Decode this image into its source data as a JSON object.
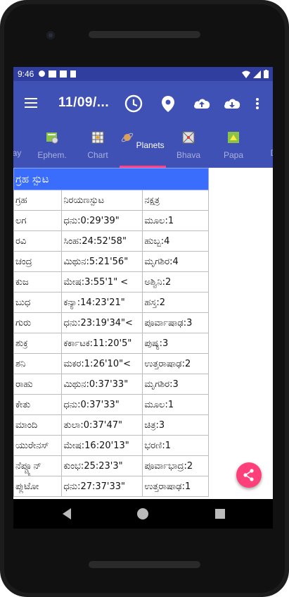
{
  "statusbar": {
    "time": "9:46"
  },
  "appbar": {
    "title": "11/09/..."
  },
  "tabs": [
    {
      "label": "ay",
      "icon": "partial-tab-icon"
    },
    {
      "label": "Ephem.",
      "icon": "ephemeris-icon"
    },
    {
      "label": "Chart",
      "icon": "chart-grid-icon"
    },
    {
      "label": "Planets",
      "icon": "planet-icon"
    },
    {
      "label": "Bhava",
      "icon": "bhava-grid-icon"
    },
    {
      "label": "Papa",
      "icon": "papa-icon"
    },
    {
      "label": "D",
      "icon": "partial-tab-icon"
    }
  ],
  "table": {
    "title": "ಗ್ರಹ ಸ್ಪುಟ",
    "headers": [
      "ಗ್ರಹ",
      "ನಿರಯಣಸ್ಪುಟ",
      "ನಕ್ಷತ್ರ"
    ],
    "rows": [
      [
        "ಲಗ",
        "ಧನು:0:29'39\"",
        "ಮೂಲ:1"
      ],
      [
        "ರವಿ",
        "ಸಿಂಹ:24:52'58\"",
        "ಹುಬ್ಬ:4"
      ],
      [
        "ಚಂದ್ರ",
        "ಮಿಥುನ:5:21'56\"",
        "ಮೃಗಶಿರ:4"
      ],
      [
        "ಕುಜ",
        "ಮೇಷ:3:55'1\" <",
        "ಅಶ್ವಿನಿ:2"
      ],
      [
        "ಬುಧ",
        "ಕನ್ಯಾ:14:23'21\"",
        "ಹಸ್ತ:2"
      ],
      [
        "ಗುರು",
        "ಧನು:23:19'34\"<",
        "ಪೂರ್ವಾಷಾಢ:3"
      ],
      [
        "ಶುಕ್ರ",
        "ಕರ್ಕಾಟಕ:11:20'5\"",
        "ಪುಷ್ಯ:3"
      ],
      [
        "ಶನಿ",
        "ಮಕರ:1:26'10\"<",
        "ಉತ್ತರಾಷಾಢ:2"
      ],
      [
        "ರಾಹು",
        "ಮಿಥುನ:0:37'33\"",
        "ಮೃಗಶಿರ:3"
      ],
      [
        "ಕೇತು",
        "ಧನು:0:37'33\"",
        "ಮೂಲ:1"
      ],
      [
        "ಮಾಂದಿ",
        "ತುಲಾ:0:37'47\"",
        "ಚಿತ್ರ:3"
      ],
      [
        "ಯುರೇನಸ್",
        "ಮೇಷ:16:20'13\"",
        "ಭರಣಿ:1"
      ],
      [
        "ನೆಪ್ಚ್ಯೂನ್",
        "ಕುಂಭ:25:23'3\"",
        "ಪೂರ್ವಾಭಾದ್ರ:2"
      ],
      [
        "ಪ್ಲುಟೋ",
        "ಧನು:27:37'33\"",
        "ಉತ್ತರಾಷಾಢ:1"
      ]
    ]
  },
  "colors": {
    "appbar": "#3f51b5",
    "statusbar": "#303f9f",
    "table_header": "#3a6dfb",
    "fab": "#ff3f79",
    "tab_indicator": "#ff4081"
  }
}
